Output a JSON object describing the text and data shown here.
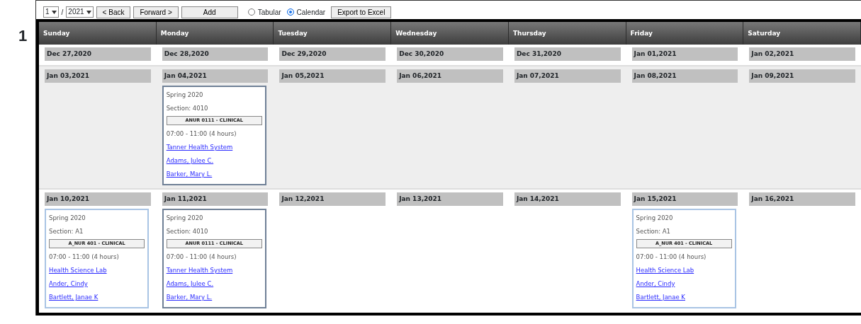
{
  "page_number": "1",
  "toolbar": {
    "month": "1",
    "separator": "/",
    "year": "2021",
    "buttons": [
      "< Back",
      "Forward >",
      "Add"
    ],
    "views": [
      {
        "label": "Tabular",
        "selected": false
      },
      {
        "label": "Calendar",
        "selected": true
      }
    ],
    "export_button": "Export to Excel"
  },
  "days": [
    "Sunday",
    "Monday",
    "Tuesday",
    "Wednesday",
    "Thursday",
    "Friday",
    "Saturday"
  ],
  "weeks": [
    {
      "shaded": false,
      "days": [
        {
          "date": "Dec 27,2020"
        },
        {
          "date": "Dec 28,2020"
        },
        {
          "date": "Dec 29,2020"
        },
        {
          "date": "Dec 30,2020"
        },
        {
          "date": "Dec 31,2020"
        },
        {
          "date": "Jan 01,2021"
        },
        {
          "date": "Jan 02,2021"
        }
      ]
    },
    {
      "shaded": true,
      "days": [
        {
          "date": "Jan 03,2021"
        },
        {
          "date": "Jan 04,2021",
          "events": [
            {
              "term": "Spring 2020",
              "section": "Section: 4010",
              "course": "ANUR 0111 - CLINICAL",
              "time": "07:00 - 11:00 (4 hours)",
              "links": [
                "Tanner Health System",
                "Adams, Julee C.",
                "Barker, Mary L."
              ],
              "color": "#6f8096"
            }
          ]
        },
        {
          "date": "Jan 05,2021"
        },
        {
          "date": "Jan 06,2021"
        },
        {
          "date": "Jan 07,2021"
        },
        {
          "date": "Jan 08,2021"
        },
        {
          "date": "Jan 09,2021"
        }
      ]
    },
    {
      "shaded": false,
      "days": [
        {
          "date": "Jan 10,2021",
          "events": [
            {
              "term": "Spring 2020",
              "section": "Section: A1",
              "course": "A_NUR 401 - CLINICAL",
              "time": "07:00 - 11:00 (4 hours)",
              "links": [
                "Health Science Lab",
                "Ander, Cindy",
                "Bartlett, Janae K"
              ],
              "color": "#a9c4e4"
            }
          ]
        },
        {
          "date": "Jan 11,2021",
          "events": [
            {
              "term": "Spring 2020",
              "section": "Section: 4010",
              "course": "ANUR 0111 - CLINICAL",
              "time": "07:00 - 11:00 (4 hours)",
              "links": [
                "Tanner Health System",
                "Adams, Julee C.",
                "Barker, Mary L."
              ],
              "color": "#6f8096"
            }
          ]
        },
        {
          "date": "Jan 12,2021"
        },
        {
          "date": "Jan 13,2021"
        },
        {
          "date": "Jan 14,2021"
        },
        {
          "date": "Jan 15,2021",
          "events": [
            {
              "term": "Spring 2020",
              "section": "Section: A1",
              "course": "A_NUR 401 - CLINICAL",
              "time": "07:00 - 11:00 (4 hours)",
              "links": [
                "Health Science Lab",
                "Ander, Cindy",
                "Bartlett, Janae K"
              ],
              "color": "#a9c4e4"
            }
          ]
        },
        {
          "date": "Jan 16,2021"
        }
      ]
    }
  ]
}
